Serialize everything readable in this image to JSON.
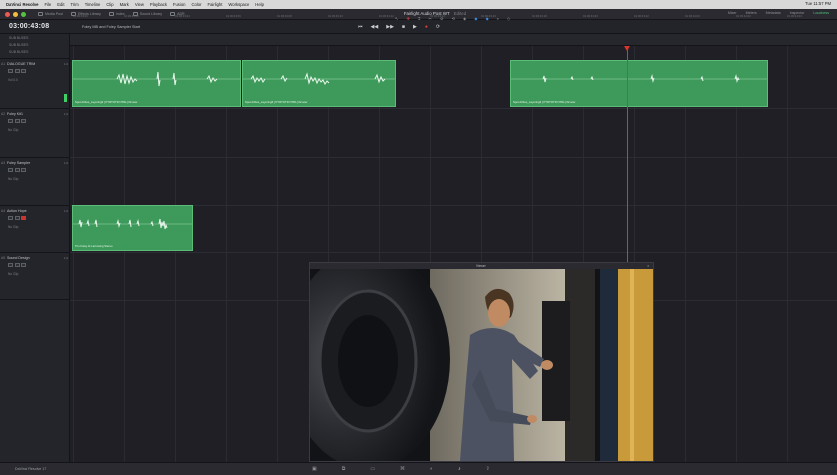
{
  "menubar": {
    "items": [
      "DaVinci Resolve",
      "File",
      "Edit",
      "Trim",
      "Timeline",
      "Clip",
      "Mark",
      "View",
      "Playback",
      "Fusion",
      "Color",
      "Fairlight",
      "Workspace",
      "Help"
    ],
    "clock": "Tue 11:57 PM"
  },
  "toolbar": {
    "left": [
      {
        "label": "Media Pool",
        "icon": "media-pool-icon"
      },
      {
        "label": "Effects Library",
        "icon": "effects-icon"
      },
      {
        "label": "Index",
        "icon": "index-icon"
      },
      {
        "label": "Sound Library",
        "icon": "sound-library-icon"
      },
      {
        "label": "ADR",
        "icon": "adr-icon"
      }
    ],
    "project_title": "Fairlight Audio Post WT",
    "project_status": "Edited",
    "right": [
      "Mixer",
      "Meters",
      "Metadata",
      "Inspector"
    ],
    "loudness": "Loudness"
  },
  "timeline": {
    "timecode": "03:00:43:08",
    "name": "Foley MB and Foley Sampler Start"
  },
  "transport": [
    "⏮",
    "◀◀",
    "▶▶",
    "■",
    "▶",
    "●",
    "⟳"
  ],
  "tools": [
    "↖",
    "✥",
    "⌶",
    "✂",
    "⊘",
    "⟲",
    "◈",
    "◆",
    "◆",
    "⌕",
    "◇"
  ],
  "subbuses": [
    "SUB BUSES",
    "SUB BUSES",
    "SUB BUSES"
  ],
  "tracks": [
    {
      "num": "A1",
      "name": "DIALOGUE TRIM",
      "level": "1.0",
      "fx": "Vol 0.0"
    },
    {
      "num": "A2",
      "name": "Foley Kit1",
      "level": "1.0",
      "fx": "No Clip"
    },
    {
      "num": "A3",
      "name": "Foley Sampler",
      "level": "1.0",
      "fx": "No Clip"
    },
    {
      "num": "A4",
      "name": "Action Hope",
      "level": "1.0",
      "fx": "No Clip"
    },
    {
      "num": "A5",
      "name": "Sound Design",
      "level": "1.0",
      "fx": "No Clip"
    }
  ],
  "ruler_ticks": [
    "01:00:43:00",
    "01:00:43:02",
    "01:00:43:04",
    "01:00:43:06",
    "01:00:43:08",
    "01:00:43:10",
    "01:00:43:12",
    "01:00:43:14",
    "01:00:43:16",
    "01:00:43:18",
    "01:00:43:20",
    "01:00:43:22",
    "01:00:44:00",
    "01:00:44:02",
    "01:00:44:04"
  ],
  "clips": [
    {
      "name": "Spot Airbus_Layering6 [ PYRTOTR NTRL] 02.wav"
    },
    {
      "name": "Spot Airbus_Layering6 [ PYRTOTR NTRL] 02.wav"
    },
    {
      "name": "Spot Airbus_Layering6 [ PYRTOTR NTRL] 02.wav"
    },
    {
      "name": "Tim Foley At Larrowing Stereo"
    }
  ],
  "viewer": {
    "title": "Viewer"
  },
  "statusbar": {
    "brand": "DaVinci Resolve 17",
    "pages": [
      "▣",
      "⧉",
      "▭",
      "⌘",
      "◐",
      "♪",
      "⇪"
    ]
  },
  "colors": {
    "clip": "#3e9a5b",
    "playhead": "#d8362f",
    "accent": "#4cc37a"
  }
}
